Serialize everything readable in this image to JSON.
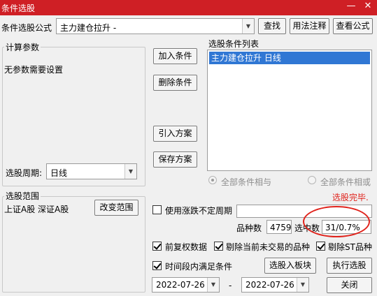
{
  "window": {
    "title": "条件选股",
    "minimize_glyph": "—",
    "close_glyph": "✕"
  },
  "formula": {
    "label": "条件选股公式",
    "value": "主力建仓拉升 -",
    "find_button": "查找",
    "usage_button": "用法注释",
    "view_button": "查看公式"
  },
  "params": {
    "group_label": "计算参数",
    "text": "无参数需要设置",
    "period_label": "选股周期:",
    "period_value": "日线"
  },
  "actions": {
    "add": "加入条件",
    "delete": "删除条件",
    "import": "引入方案",
    "save": "保存方案"
  },
  "conditions": {
    "label": "选股条件列表",
    "items": [
      "主力建仓拉升  日线"
    ],
    "radio_and": "全部条件相与",
    "radio_or": "全部条件相或",
    "status": "选股完毕.",
    "status_color": "#e0231c"
  },
  "scope": {
    "group_label": "选股范围",
    "text": "上证A股 深证A股",
    "change_button": "改变范围"
  },
  "options": {
    "uncertain_period_label": "使用涨跌不定周期",
    "count_label": "品种数",
    "count_value": "4759",
    "selected_label": "选中数",
    "selected_value": "31/0.7%",
    "adjusted_label": "前复权数据",
    "exclude_not_traded_label": "剔除当前未交易的品种",
    "exclude_st_label": "剔除ST品种",
    "time_range_label": "时间段内满足条件",
    "to_block_button": "选股入板块",
    "execute_button": "执行选股",
    "date_from": "2022-07-26",
    "date_sep": "-",
    "date_to": "2022-07-26",
    "close_button": "关闭"
  }
}
